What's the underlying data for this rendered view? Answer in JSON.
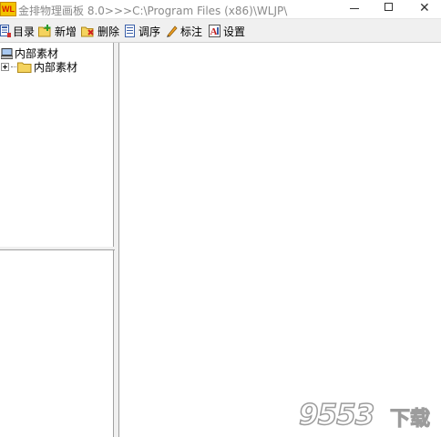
{
  "window": {
    "icon_text": "WL",
    "title": "金排物理画板 8.0>>>C:\\Program Files (x86)\\WLJP\\",
    "close_glyph": "✕"
  },
  "toolbar": {
    "items": [
      {
        "label": "目录",
        "icon": "catalog-icon"
      },
      {
        "label": "新增",
        "icon": "add-folder-icon"
      },
      {
        "label": "删除",
        "icon": "delete-folder-icon"
      },
      {
        "label": "调序",
        "icon": "reorder-icon"
      },
      {
        "label": "标注",
        "icon": "pencil-icon"
      },
      {
        "label": "设置",
        "icon": "settings-icon"
      }
    ]
  },
  "tree": {
    "root": {
      "label": "内部素材",
      "icon": "computer-icon"
    },
    "children": [
      {
        "label": "内部素材",
        "icon": "folder-icon",
        "expander": "plus"
      }
    ]
  },
  "watermark": {
    "numbers": "9553",
    "text": "下载"
  },
  "colors": {
    "title_text": "#8a8a8a",
    "folder": "#f4d35e",
    "app_icon": "#f2c300"
  }
}
